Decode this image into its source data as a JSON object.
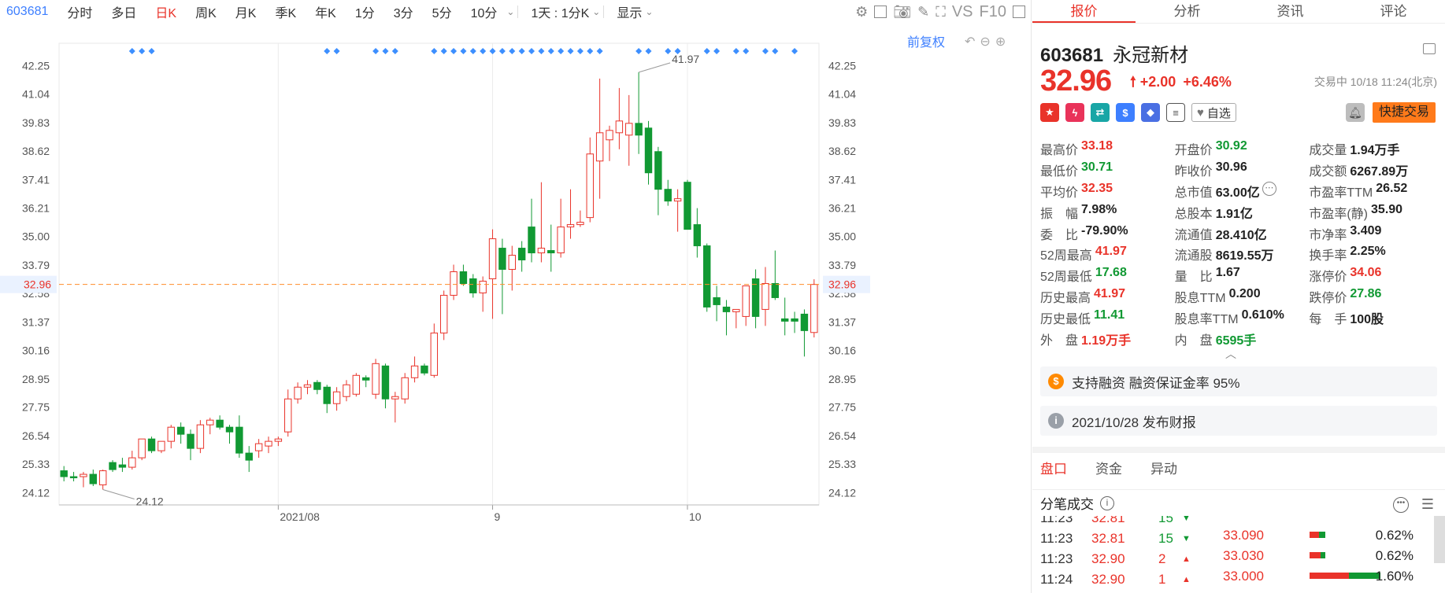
{
  "toolbar": {
    "code": "603681",
    "items": [
      "分时",
      "多日",
      "日K",
      "周K",
      "月K",
      "季K",
      "年K",
      "1分",
      "3分",
      "5分",
      "10分"
    ],
    "active_index": 2,
    "period_select": "1天 : 1分K",
    "display_label": "显示",
    "vs_label": "VS",
    "f10_label": "F10"
  },
  "chart_header": {
    "fq_label": "前复权"
  },
  "chart_data": {
    "type": "candlestick",
    "y_ticks": [
      42.25,
      41.04,
      39.83,
      38.62,
      37.41,
      36.21,
      35.0,
      33.79,
      32.58,
      31.37,
      30.16,
      28.95,
      27.75,
      26.54,
      25.33,
      24.12
    ],
    "ylim": [
      23.6,
      43.2
    ],
    "x_labels": [
      {
        "label": "2021/08",
        "index": 22
      },
      {
        "label": "9",
        "index": 44
      },
      {
        "label": "10",
        "index": 64
      }
    ],
    "current_price_label": "32.96",
    "current_price": 32.96,
    "high_annotation": "41.97",
    "low_annotation": "24.12",
    "marker_indices": [
      7,
      8,
      9,
      27,
      28,
      32,
      33,
      34,
      38,
      39,
      40,
      41,
      42,
      43,
      44,
      45,
      46,
      47,
      48,
      49,
      50,
      51,
      52,
      53,
      54,
      55,
      59,
      60,
      62,
      63,
      66,
      67,
      69,
      70,
      72,
      73,
      75
    ],
    "candles": [
      {
        "o": 25.05,
        "h": 25.25,
        "l": 24.6,
        "c": 24.8
      },
      {
        "o": 24.8,
        "h": 25.0,
        "l": 24.6,
        "c": 24.75
      },
      {
        "o": 24.8,
        "h": 25.0,
        "l": 24.35,
        "c": 24.9
      },
      {
        "o": 24.9,
        "h": 25.1,
        "l": 24.4,
        "c": 24.5
      },
      {
        "o": 24.45,
        "h": 25.1,
        "l": 24.25,
        "c": 25.05
      },
      {
        "o": 25.4,
        "h": 25.5,
        "l": 25.0,
        "c": 25.1
      },
      {
        "o": 25.3,
        "h": 25.6,
        "l": 25.0,
        "c": 25.2
      },
      {
        "o": 25.2,
        "h": 25.9,
        "l": 25.1,
        "c": 25.6
      },
      {
        "o": 25.6,
        "h": 26.4,
        "l": 25.5,
        "c": 26.4
      },
      {
        "o": 26.4,
        "h": 26.5,
        "l": 25.8,
        "c": 25.9
      },
      {
        "o": 25.9,
        "h": 26.3,
        "l": 25.8,
        "c": 26.3
      },
      {
        "o": 26.3,
        "h": 27.0,
        "l": 26.0,
        "c": 26.9
      },
      {
        "o": 26.9,
        "h": 27.1,
        "l": 26.2,
        "c": 26.6
      },
      {
        "o": 26.6,
        "h": 26.8,
        "l": 25.5,
        "c": 26.0
      },
      {
        "o": 26.0,
        "h": 27.2,
        "l": 25.8,
        "c": 27.0
      },
      {
        "o": 27.0,
        "h": 27.3,
        "l": 26.6,
        "c": 27.2
      },
      {
        "o": 27.2,
        "h": 27.4,
        "l": 26.8,
        "c": 26.9
      },
      {
        "o": 26.9,
        "h": 27.0,
        "l": 26.2,
        "c": 26.7
      },
      {
        "o": 26.9,
        "h": 27.4,
        "l": 25.6,
        "c": 25.8
      },
      {
        "o": 25.8,
        "h": 26.1,
        "l": 25.0,
        "c": 25.5
      },
      {
        "o": 25.9,
        "h": 26.4,
        "l": 25.6,
        "c": 26.2
      },
      {
        "o": 26.1,
        "h": 26.5,
        "l": 25.8,
        "c": 26.3
      },
      {
        "o": 26.3,
        "h": 26.5,
        "l": 26.1,
        "c": 26.4
      },
      {
        "o": 26.7,
        "h": 28.5,
        "l": 26.5,
        "c": 28.1
      },
      {
        "o": 28.1,
        "h": 28.8,
        "l": 27.9,
        "c": 28.6
      },
      {
        "o": 28.6,
        "h": 28.9,
        "l": 28.3,
        "c": 28.7
      },
      {
        "o": 28.8,
        "h": 28.9,
        "l": 28.3,
        "c": 28.5
      },
      {
        "o": 28.6,
        "h": 28.7,
        "l": 27.5,
        "c": 27.9
      },
      {
        "o": 27.9,
        "h": 28.6,
        "l": 27.6,
        "c": 28.4
      },
      {
        "o": 28.2,
        "h": 28.9,
        "l": 28.0,
        "c": 28.7
      },
      {
        "o": 28.3,
        "h": 29.2,
        "l": 28.2,
        "c": 29.1
      },
      {
        "o": 29.0,
        "h": 29.1,
        "l": 28.6,
        "c": 28.9
      },
      {
        "o": 28.3,
        "h": 29.8,
        "l": 28.1,
        "c": 29.6
      },
      {
        "o": 29.5,
        "h": 29.6,
        "l": 27.7,
        "c": 28.1
      },
      {
        "o": 28.1,
        "h": 28.4,
        "l": 27.1,
        "c": 28.2
      },
      {
        "o": 28.1,
        "h": 29.2,
        "l": 27.9,
        "c": 29.0
      },
      {
        "o": 29.0,
        "h": 29.9,
        "l": 28.8,
        "c": 29.5
      },
      {
        "o": 29.5,
        "h": 29.6,
        "l": 29.1,
        "c": 29.2
      },
      {
        "o": 29.1,
        "h": 31.3,
        "l": 29.0,
        "c": 30.9
      },
      {
        "o": 30.9,
        "h": 32.7,
        "l": 30.6,
        "c": 32.5
      },
      {
        "o": 32.5,
        "h": 33.8,
        "l": 32.3,
        "c": 33.5
      },
      {
        "o": 33.5,
        "h": 33.8,
        "l": 32.9,
        "c": 33.0
      },
      {
        "o": 33.2,
        "h": 33.4,
        "l": 32.4,
        "c": 32.6
      },
      {
        "o": 32.6,
        "h": 33.3,
        "l": 31.8,
        "c": 33.1
      },
      {
        "o": 33.2,
        "h": 35.3,
        "l": 31.5,
        "c": 34.9
      },
      {
        "o": 34.5,
        "h": 34.9,
        "l": 31.7,
        "c": 33.6
      },
      {
        "o": 33.6,
        "h": 34.6,
        "l": 32.7,
        "c": 34.2
      },
      {
        "o": 34.5,
        "h": 34.8,
        "l": 33.5,
        "c": 34.0
      },
      {
        "o": 35.4,
        "h": 36.6,
        "l": 33.9,
        "c": 34.3
      },
      {
        "o": 34.3,
        "h": 37.3,
        "l": 33.9,
        "c": 34.5
      },
      {
        "o": 34.4,
        "h": 35.5,
        "l": 33.5,
        "c": 34.3
      },
      {
        "o": 34.3,
        "h": 36.6,
        "l": 34.1,
        "c": 35.4
      },
      {
        "o": 35.4,
        "h": 37.0,
        "l": 34.9,
        "c": 35.5
      },
      {
        "o": 35.5,
        "h": 36.1,
        "l": 35.4,
        "c": 35.6
      },
      {
        "o": 35.8,
        "h": 39.2,
        "l": 35.6,
        "c": 38.5
      },
      {
        "o": 38.2,
        "h": 41.7,
        "l": 36.6,
        "c": 39.4
      },
      {
        "o": 39.1,
        "h": 39.7,
        "l": 38.2,
        "c": 39.5
      },
      {
        "o": 39.4,
        "h": 41.3,
        "l": 38.7,
        "c": 39.9
      },
      {
        "o": 39.3,
        "h": 41.0,
        "l": 38.0,
        "c": 39.8
      },
      {
        "o": 39.8,
        "h": 41.97,
        "l": 38.5,
        "c": 39.3
      },
      {
        "o": 39.6,
        "h": 39.9,
        "l": 37.2,
        "c": 37.7
      },
      {
        "o": 38.6,
        "h": 38.8,
        "l": 35.9,
        "c": 37.0
      },
      {
        "o": 37.0,
        "h": 37.4,
        "l": 36.3,
        "c": 36.5
      },
      {
        "o": 36.5,
        "h": 37.0,
        "l": 35.2,
        "c": 36.6
      },
      {
        "o": 37.3,
        "h": 37.4,
        "l": 35.4,
        "c": 35.3
      },
      {
        "o": 35.5,
        "h": 36.2,
        "l": 34.1,
        "c": 34.6
      },
      {
        "o": 34.6,
        "h": 34.7,
        "l": 31.8,
        "c": 32.0
      },
      {
        "o": 32.4,
        "h": 32.9,
        "l": 31.4,
        "c": 32.1
      },
      {
        "o": 32.0,
        "h": 32.3,
        "l": 30.8,
        "c": 31.8
      },
      {
        "o": 31.8,
        "h": 31.9,
        "l": 31.1,
        "c": 31.9
      },
      {
        "o": 31.6,
        "h": 32.8,
        "l": 31.2,
        "c": 32.9
      },
      {
        "o": 33.2,
        "h": 33.6,
        "l": 31.1,
        "c": 31.6
      },
      {
        "o": 31.9,
        "h": 33.7,
        "l": 31.2,
        "c": 33.0
      },
      {
        "o": 33.0,
        "h": 34.4,
        "l": 32.3,
        "c": 32.4
      },
      {
        "o": 31.5,
        "h": 32.4,
        "l": 30.8,
        "c": 31.4
      },
      {
        "o": 31.5,
        "h": 31.8,
        "l": 30.9,
        "c": 31.4
      },
      {
        "o": 31.7,
        "h": 31.9,
        "l": 29.9,
        "c": 31.0
      },
      {
        "o": 30.92,
        "h": 33.18,
        "l": 30.71,
        "c": 32.96
      }
    ]
  },
  "right_tabs": [
    "报价",
    "分析",
    "资讯",
    "评论"
  ],
  "stock": {
    "code": "603681",
    "name": "永冠新材",
    "price": "32.96",
    "change": "+2.00",
    "change_pct": "+6.46%",
    "trade_info": "交易中 10/18 11:24(北京)",
    "watch_label": "自选",
    "quick_trade_label": "快捷交易"
  },
  "quote_grid": [
    [
      {
        "label": "最高价",
        "value": "33.18",
        "color": "red"
      },
      {
        "label": "开盘价",
        "value": "30.92",
        "color": "green"
      },
      {
        "label": "成交量",
        "value": "1.94万手",
        "color": "blk"
      }
    ],
    [
      {
        "label": "最低价",
        "value": "30.71",
        "color": "green"
      },
      {
        "label": "昨收价",
        "value": "30.96",
        "color": "blk"
      },
      {
        "label": "成交额",
        "value": "6267.89万",
        "color": "blk"
      }
    ],
    [
      {
        "label": "平均价",
        "value": "32.35",
        "color": "red"
      },
      {
        "label": "总市值",
        "value": "63.00亿",
        "color": "blk"
      },
      {
        "label": "市盈率TTM",
        "value": "26.52",
        "color": "blk"
      }
    ],
    [
      {
        "label": "振　幅",
        "value": "7.98%",
        "color": "blk"
      },
      {
        "label": "总股本",
        "value": "1.91亿",
        "color": "blk"
      },
      {
        "label": "市盈率(静)",
        "value": "35.90",
        "color": "blk"
      }
    ],
    [
      {
        "label": "委　比",
        "value": "-79.90%",
        "color": "blk"
      },
      {
        "label": "流通值",
        "value": "28.410亿",
        "color": "blk"
      },
      {
        "label": "市净率",
        "value": "3.409",
        "color": "blk"
      }
    ],
    [
      {
        "label": "52周最高",
        "value": "41.97",
        "color": "red"
      },
      {
        "label": "流通股",
        "value": "8619.55万",
        "color": "blk"
      },
      {
        "label": "换手率",
        "value": "2.25%",
        "color": "blk"
      }
    ],
    [
      {
        "label": "52周最低",
        "value": "17.68",
        "color": "green"
      },
      {
        "label": "量　比",
        "value": "1.67",
        "color": "blk"
      },
      {
        "label": "涨停价",
        "value": "34.06",
        "color": "red"
      }
    ],
    [
      {
        "label": "历史最高",
        "value": "41.97",
        "color": "red"
      },
      {
        "label": "股息TTM",
        "value": "0.200",
        "color": "blk"
      },
      {
        "label": "跌停价",
        "value": "27.86",
        "color": "green"
      }
    ],
    [
      {
        "label": "历史最低",
        "value": "11.41",
        "color": "green"
      },
      {
        "label": "股息率TTM",
        "value": "0.610%",
        "color": "blk"
      },
      {
        "label": "每　手",
        "value": "100股",
        "color": "blk"
      }
    ],
    [
      {
        "label": "外　盘",
        "value": "1.19万手",
        "color": "red"
      },
      {
        "label": "内　盘",
        "value": "6595手",
        "color": "green"
      },
      {
        "label": "",
        "value": "",
        "color": "blk"
      }
    ]
  ],
  "notices": [
    {
      "icon": "$",
      "text": "支持融资 融资保证金率 95%",
      "color": "#ff8a00"
    },
    {
      "icon": "i",
      "text": "2021/10/28  发布财报",
      "color": "#9aa0a8"
    }
  ],
  "panel_tabs": [
    "盘口",
    "资金",
    "异动"
  ],
  "tape_title": "分笔成交",
  "tape": [
    {
      "time": "11:23",
      "price": "32.81",
      "vol": "15",
      "dir": "down"
    },
    {
      "time": "11:23",
      "price": "32.81",
      "vol": "15",
      "dir": "down"
    },
    {
      "time": "11:23",
      "price": "32.90",
      "vol": "2",
      "dir": "up"
    },
    {
      "time": "11:24",
      "price": "32.90",
      "vol": "1",
      "dir": "up"
    }
  ],
  "order_book": [
    {
      "price": "33.090",
      "pct": "0.62%",
      "red": 12,
      "green": 8
    },
    {
      "price": "33.030",
      "pct": "0.62%",
      "red": 14,
      "green": 6
    },
    {
      "price": "33.000",
      "pct": "1.60%",
      "red": 50,
      "green": 40
    }
  ],
  "colors": {
    "up": "#e9332a",
    "down": "#119933",
    "accent": "#3d7fff",
    "price_line": "#ff8c2a"
  }
}
